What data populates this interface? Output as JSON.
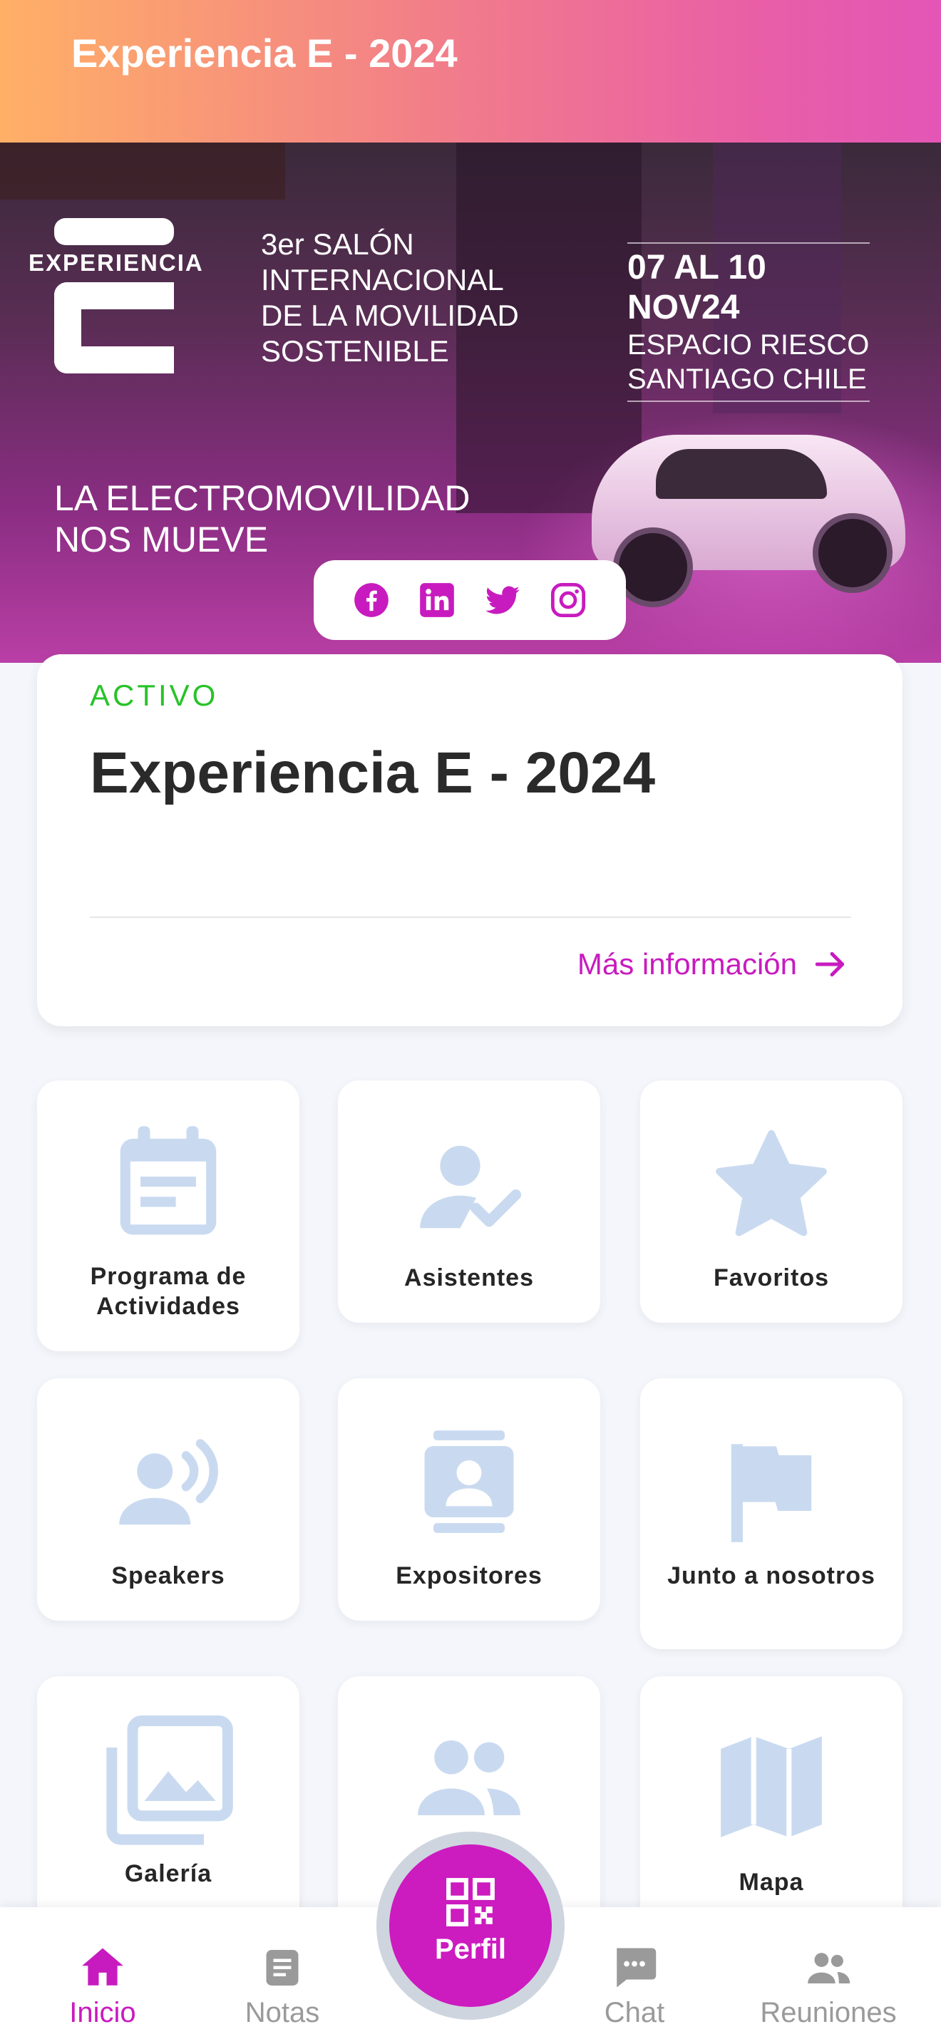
{
  "app": {
    "header_title": "Experiencia E - 2024"
  },
  "banner": {
    "logo_word": "EXPERIENCIA",
    "salon_lines": [
      "3er SALÓN",
      "INTERNACIONAL",
      "DE LA MOVILIDAD",
      "SOSTENIBLE"
    ],
    "date_line": "07 AL 10 NOV24",
    "venue_line1": "ESPACIO RIESCO",
    "venue_line2": "SANTIAGO CHILE",
    "tagline_line1": "LA ELECTROMOVILIDAD",
    "tagline_line2": "NOS MUEVE"
  },
  "social": {
    "icons": [
      "facebook-icon",
      "linkedin-icon",
      "twitter-icon",
      "instagram-icon"
    ],
    "color": "#c81bbf"
  },
  "event_card": {
    "status": "ACTIVO",
    "status_color": "#27c327",
    "title": "Experiencia E - 2024",
    "more_link": "Más información"
  },
  "tiles": [
    {
      "label": "Programa de Actividades",
      "icon": "calendar-icon"
    },
    {
      "label": "Asistentes",
      "icon": "user-check-icon"
    },
    {
      "label": "Favoritos",
      "icon": "star-icon"
    },
    {
      "label": "Speakers",
      "icon": "speaker-icon"
    },
    {
      "label": "Expositores",
      "icon": "contact-card-icon"
    },
    {
      "label": "Junto a nosotros",
      "icon": "flag-icon"
    },
    {
      "label": "Galería",
      "icon": "gallery-icon"
    },
    {
      "label": "",
      "icon": "group-icon"
    },
    {
      "label": "Mapa",
      "icon": "map-icon"
    }
  ],
  "tile_icon_color": "#c9daf0",
  "bottom_nav": {
    "items": [
      {
        "label": "Inicio",
        "icon": "home-icon",
        "active": true
      },
      {
        "label": "Notas",
        "icon": "notes-icon",
        "active": false
      },
      {
        "label": "Chat",
        "icon": "chat-icon",
        "active": false
      },
      {
        "label": "Reuniones",
        "icon": "people-icon",
        "active": false
      }
    ],
    "fab_label": "Perfil",
    "fab_icon": "qr-code-icon",
    "accent": "#cc1bbf"
  }
}
